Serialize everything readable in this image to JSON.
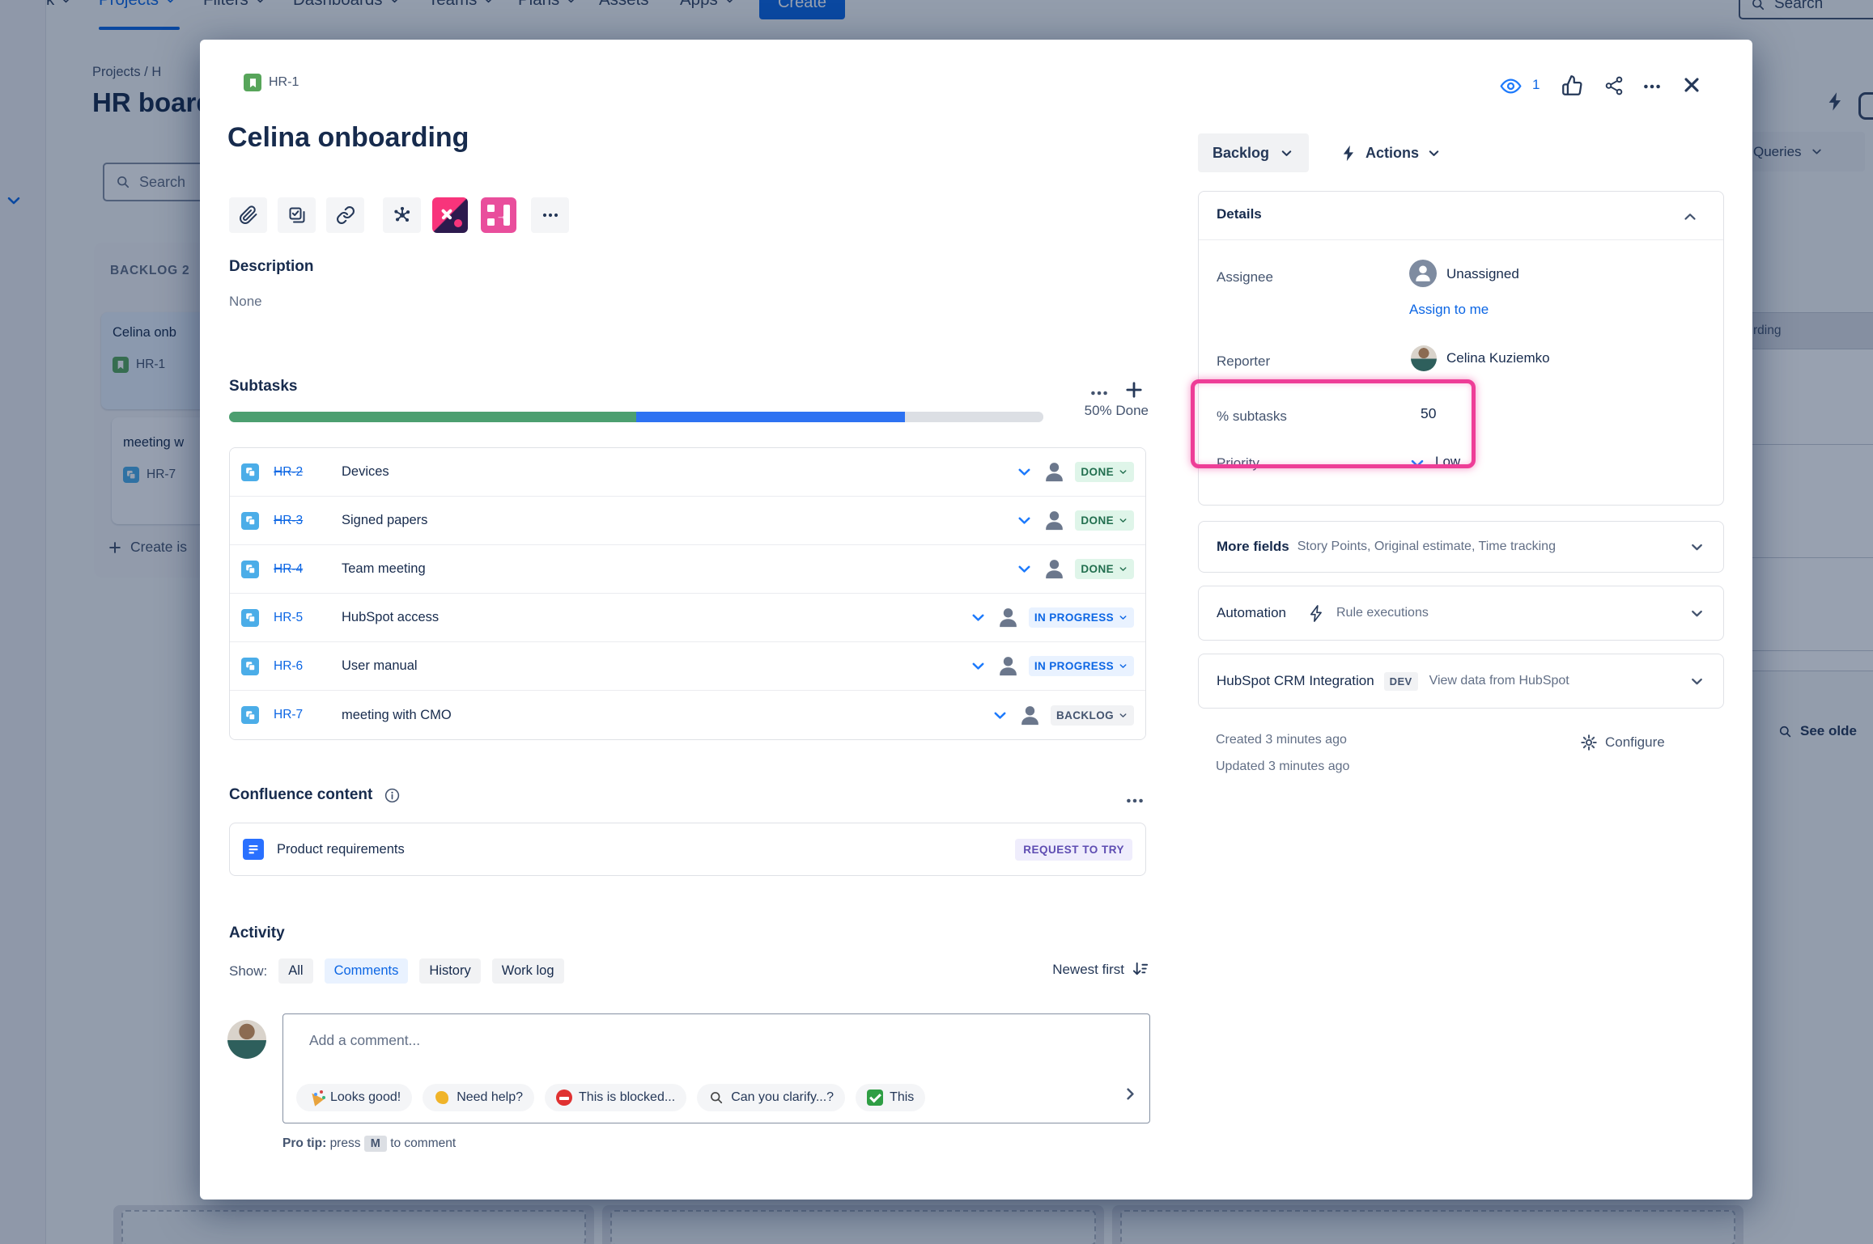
{
  "colors": {
    "accent_blue": "#0C66E4",
    "link_blue": "#0C66E4",
    "highlight_pink": "#EE3D97",
    "progress_done_green": "#4C9F70",
    "progress_inprogress_blue": "#2D72F2",
    "progress_todo_gray": "#DCDFE4",
    "status_done_bg": "#DFF5E9",
    "status_done_text": "#216E4E",
    "status_inprogress_bg": "#E9F2FF",
    "status_inprogress_text": "#0C66E4",
    "status_backlog_bg": "#F1F2F4",
    "status_backlog_text": "#44546F",
    "story_icon_green": "#57A55A",
    "subtask_icon_blue": "#4BADE8",
    "confluence_doc_blue": "#2970FF",
    "request_badge_purple": "#5E4DB2"
  },
  "icons": {
    "story-icon": "green tile with white bookmark",
    "subtask-icon": "blue tile with overlapping squares",
    "watchers-eye-icon": "eye",
    "like-icon": "thumbs up",
    "share-icon": "share nodes",
    "more-icon": "ellipsis",
    "close-icon": "x",
    "attach-icon": "paperclip",
    "add-child-icon": "checkbox sheet",
    "link-icon": "chain link",
    "graph-icon": "node network",
    "hubspot-icon": "pink/navy tile",
    "board-app-icon": "pink tile",
    "lightning-icon": "bolt",
    "gear-icon": "gear",
    "info-icon": "circled i",
    "search-icon": "magnifier",
    "sort-icon": "arrow down with bars",
    "chevron-down-icon": "v",
    "priority-low-icon": "blue chevron down",
    "avatar-icon": "person silhouette",
    "party-icon": "party popper",
    "wave-icon": "waving hand",
    "no-entry-icon": "red no-entry",
    "check-icon": "green check"
  },
  "nav": {
    "items": [
      "ur work",
      "Projects",
      "Filters",
      "Dashboards",
      "Teams",
      "Plans",
      "Assets",
      "Apps"
    ],
    "active_item": "Projects",
    "create_label": "Create",
    "search_placeholder": "Search"
  },
  "background": {
    "breadcrumb": "Projects / H",
    "board_title": "HR board",
    "search_placeholder": "Search",
    "column_header": "BACKLOG 2",
    "cards": [
      {
        "title": "Celina onb",
        "key": "HR-1"
      },
      {
        "title": "meeting w",
        "key": "HR-7"
      }
    ],
    "create_issue_label": "Create is",
    "right_panel": {
      "queries_label": "Queries",
      "row_fragment": "rding",
      "see_older_label": "See olde"
    }
  },
  "modal": {
    "issue_key": "HR-1",
    "watchers_count": "1",
    "title": "Celina onboarding",
    "description": {
      "heading": "Description",
      "value": "None"
    },
    "subtasks": {
      "heading": "Subtasks",
      "progress_label": "50% Done",
      "progress": {
        "done_pct": 50,
        "in_progress_pct": 33,
        "todo_pct": 17
      },
      "items": [
        {
          "key": "HR-2",
          "summary": "Devices",
          "status": "DONE"
        },
        {
          "key": "HR-3",
          "summary": "Signed papers",
          "status": "DONE"
        },
        {
          "key": "HR-4",
          "summary": "Team meeting",
          "status": "DONE"
        },
        {
          "key": "HR-5",
          "summary": "HubSpot access",
          "status": "IN PROGRESS"
        },
        {
          "key": "HR-6",
          "summary": "User manual",
          "status": "IN PROGRESS"
        },
        {
          "key": "HR-7",
          "summary": "meeting with CMO",
          "status": "BACKLOG"
        }
      ]
    },
    "confluence": {
      "heading": "Confluence content",
      "page_title": "Product requirements",
      "badge": "REQUEST TO TRY"
    },
    "activity": {
      "heading": "Activity",
      "show_label": "Show:",
      "filters": [
        "All",
        "Comments",
        "History",
        "Work log"
      ],
      "active_filter": "Comments",
      "sort_label": "Newest first"
    },
    "comment": {
      "placeholder": "Add a comment...",
      "quick_replies": [
        {
          "icon": "party-icon",
          "label": "Looks good!"
        },
        {
          "icon": "wave-icon",
          "label": "Need help?"
        },
        {
          "icon": "no-entry-icon",
          "label": "This is blocked..."
        },
        {
          "icon": "search-icon",
          "label": "Can you clarify...?"
        },
        {
          "icon": "check-icon",
          "label": "This"
        }
      ],
      "pro_tip_prefix": "Pro tip:",
      "pro_tip_mid": "press",
      "pro_tip_key": "M",
      "pro_tip_suffix": "to comment"
    },
    "sidebar": {
      "status_button_label": "Backlog",
      "actions_label": "Actions",
      "details": {
        "heading": "Details",
        "assignee_label": "Assignee",
        "assignee_value": "Unassigned",
        "assign_to_me_label": "Assign to me",
        "reporter_label": "Reporter",
        "reporter_value": "Celina Kuziemko",
        "subtasks_pct_label": "% subtasks",
        "subtasks_pct_value": "50",
        "priority_label": "Priority",
        "priority_value": "Low"
      },
      "more_fields": {
        "label": "More fields",
        "summary": "Story Points, Original estimate, Time tracking"
      },
      "automation": {
        "label": "Automation",
        "summary": "Rule executions"
      },
      "hubspot": {
        "label": "HubSpot CRM Integration",
        "badge": "DEV",
        "summary": "View data from HubSpot"
      },
      "created_label": "Created 3 minutes ago",
      "updated_label": "Updated 3 minutes ago",
      "configure_label": "Configure"
    }
  }
}
